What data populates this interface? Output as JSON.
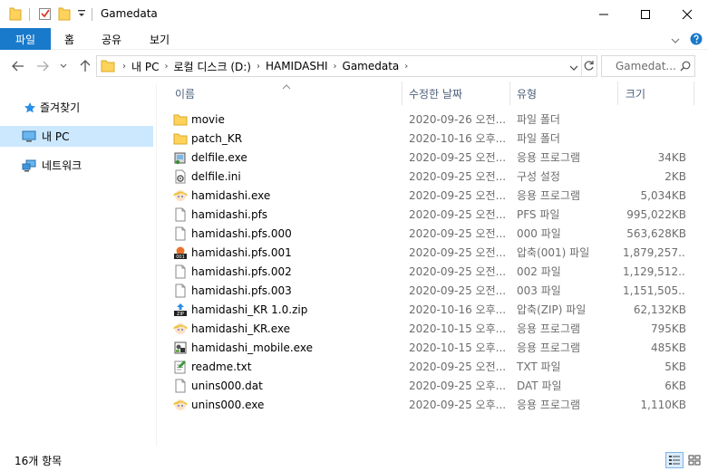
{
  "window": {
    "title": "Gamedata",
    "minimize_icon": "minimize-icon",
    "maximize_icon": "maximize-icon",
    "close_icon": "close-icon"
  },
  "ribbon": {
    "tabs": [
      {
        "label": "파일",
        "active": true
      },
      {
        "label": "홈"
      },
      {
        "label": "공유"
      },
      {
        "label": "보기"
      }
    ],
    "accent_color": "#1979ca"
  },
  "address": {
    "crumbs": [
      "내 PC",
      "로컬 디스크 (D:)",
      "HAMIDASHI",
      "Gamedata"
    ],
    "search_placeholder": "Gamedat..."
  },
  "sidebar": {
    "items": [
      {
        "label": "즐겨찾기",
        "icon": "star-icon"
      },
      {
        "label": "내 PC",
        "icon": "pc-icon",
        "selected": true
      },
      {
        "label": "네트워크",
        "icon": "network-icon"
      }
    ]
  },
  "columns": {
    "name": "이름",
    "date": "수정한 날짜",
    "type": "유형",
    "size": "크기"
  },
  "files": [
    {
      "name": "movie",
      "date": "2020-09-26 오전...",
      "type": "파일 폴더",
      "size": "",
      "icon": "folder-icon"
    },
    {
      "name": "patch_KR",
      "date": "2020-10-16 오후...",
      "type": "파일 폴더",
      "size": "",
      "icon": "folder-icon"
    },
    {
      "name": "delfile.exe",
      "date": "2020-09-25 오전...",
      "type": "응용 프로그램",
      "size": "34KB",
      "icon": "installer-icon"
    },
    {
      "name": "delfile.ini",
      "date": "2020-09-25 오전...",
      "type": "구성 설정",
      "size": "2KB",
      "icon": "settings-file-icon"
    },
    {
      "name": "hamidashi.exe",
      "date": "2020-09-25 오전...",
      "type": "응용 프로그램",
      "size": "5,034KB",
      "icon": "app-character-icon"
    },
    {
      "name": "hamidashi.pfs",
      "date": "2020-09-25 오전...",
      "type": "PFS 파일",
      "size": "995,022KB",
      "icon": "blank-file-icon"
    },
    {
      "name": "hamidashi.pfs.000",
      "date": "2020-09-25 오전...",
      "type": "000 파일",
      "size": "563,628KB",
      "icon": "blank-file-icon"
    },
    {
      "name": "hamidashi.pfs.001",
      "date": "2020-09-25 오전...",
      "type": "압축(001) 파일",
      "size": "1,879,257...",
      "icon": "archive-001-icon"
    },
    {
      "name": "hamidashi.pfs.002",
      "date": "2020-09-25 오전...",
      "type": "002 파일",
      "size": "1,129,512...",
      "icon": "blank-file-icon"
    },
    {
      "name": "hamidashi.pfs.003",
      "date": "2020-09-25 오전...",
      "type": "003 파일",
      "size": "1,151,505...",
      "icon": "blank-file-icon"
    },
    {
      "name": "hamidashi_KR 1.0.zip",
      "date": "2020-10-16 오후...",
      "type": "압축(ZIP) 파일",
      "size": "62,132KB",
      "icon": "zip-icon"
    },
    {
      "name": "hamidashi_KR.exe",
      "date": "2020-10-15 오후...",
      "type": "응용 프로그램",
      "size": "795KB",
      "icon": "app-character-icon"
    },
    {
      "name": "hamidashi_mobile.exe",
      "date": "2020-10-15 오후...",
      "type": "응용 프로그램",
      "size": "485KB",
      "icon": "app-mobile-icon"
    },
    {
      "name": "readme.txt",
      "date": "2020-09-25 오전...",
      "type": "TXT 파일",
      "size": "5KB",
      "icon": "text-file-icon"
    },
    {
      "name": "unins000.dat",
      "date": "2020-09-25 오후...",
      "type": "DAT 파일",
      "size": "6KB",
      "icon": "blank-file-icon"
    },
    {
      "name": "unins000.exe",
      "date": "2020-09-25 오후...",
      "type": "응용 프로그램",
      "size": "1,110KB",
      "icon": "app-character-icon"
    }
  ],
  "status": {
    "count": "16개 항목"
  }
}
